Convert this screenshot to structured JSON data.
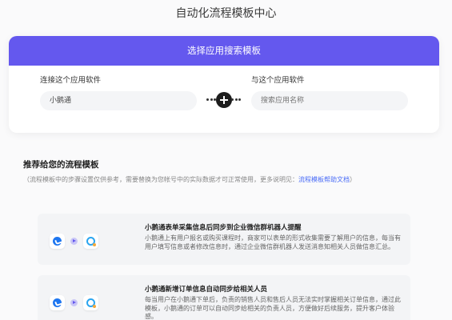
{
  "page": {
    "title": "自动化流程模板中心"
  },
  "picker": {
    "header": "选择应用搜索模板",
    "left_label": "连接这个应用软件",
    "left_value": "小鹅通",
    "right_label": "与这个应用软件",
    "right_placeholder": "搜索应用名称",
    "accent_color": "#6458ee"
  },
  "recommend": {
    "title": "推荐给您的流程模板",
    "desc": "（流程模板中的步骤设置仅供参考，需要替换为您帐号中的实际数据才可正常使用，更多说明见：",
    "link": "流程模板帮助文档",
    "desc_end": "）"
  },
  "templates": [
    {
      "title": "小鹅通表单采集信息后同步到企业微信群机器人提醒",
      "desc": "小鹅通上有用户报名或购买课程时，商家可以表单的形式收集需要了解用户的信息，每当有用户填写信息或者修改信息时，通过企业微信群机器人发送消息知相关人员做信息汇总。",
      "source_icon": "xiaoetong-icon",
      "target_icon": "wecom-icon"
    },
    {
      "title": "小鹅通新增订单信息自动同步给相关人员",
      "desc": "每当用户在小鹅通下单后，负责的销售人员和售后人员无法实时掌握相关订单信息，通过此模板，小鹅通的订单可以自动同步给相关的负责人员，方便做好后续服务，提升客户体验感。",
      "source_icon": "xiaoetong-icon",
      "target_icon": "wecom-icon"
    }
  ]
}
